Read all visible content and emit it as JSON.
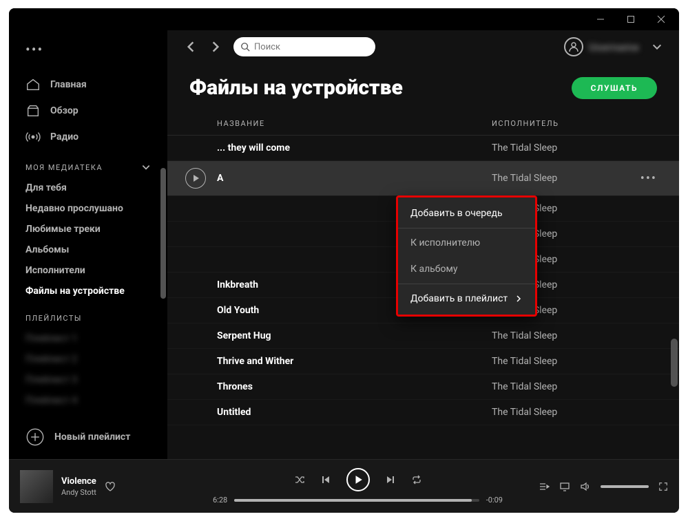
{
  "titlebar": {
    "min": "minimize",
    "max": "maximize",
    "close": "close"
  },
  "sidebar": {
    "nav": [
      {
        "label": "Главная",
        "icon": "home"
      },
      {
        "label": "Обзор",
        "icon": "browse"
      },
      {
        "label": "Радио",
        "icon": "radio"
      }
    ],
    "library_header": "МОЯ МЕДИАТЕКА",
    "library": [
      {
        "label": "Для тебя"
      },
      {
        "label": "Недавно прослушано"
      },
      {
        "label": "Любимые треки"
      },
      {
        "label": "Альбомы"
      },
      {
        "label": "Исполнители"
      },
      {
        "label": "Файлы на устройстве",
        "active": true
      }
    ],
    "playlists_header": "ПЛЕЙЛИСТЫ",
    "playlists": [
      "Плейлист 1",
      "Плейлист 2",
      "Плейлист 3",
      "Плейлист 4"
    ],
    "new_playlist": "Новый плейлист"
  },
  "search": {
    "placeholder": "Поиск"
  },
  "user": {
    "name": "Username"
  },
  "page": {
    "title": "Файлы на устройстве",
    "listen": "СЛУШАТЬ",
    "col_title": "НАЗВАНИЕ",
    "col_artist": "ИСПОЛНИТЕЛЬ"
  },
  "tracks": [
    {
      "title": "... they will come",
      "artist": "The Tidal Sleep"
    },
    {
      "title": "A",
      "artist": "The Tidal Sleep",
      "selected": true
    },
    {
      "title": "",
      "artist": "The Tidal Sleep"
    },
    {
      "title": "",
      "artist": "The Tidal Sleep"
    },
    {
      "title": "",
      "artist": "The Tidal Sleep"
    },
    {
      "title": "Inkbreath",
      "artist": "The Tidal Sleep"
    },
    {
      "title": "Old Youth",
      "artist": "The Tidal Sleep"
    },
    {
      "title": "Serpent Hug",
      "artist": "The Tidal Sleep"
    },
    {
      "title": "Thrive and Wither",
      "artist": "The Tidal Sleep"
    },
    {
      "title": "Thrones",
      "artist": "The Tidal Sleep"
    },
    {
      "title": "Untitled",
      "artist": "The Tidal Sleep"
    }
  ],
  "context_menu": {
    "add_queue": "Добавить в очередь",
    "to_artist": "К исполнителю",
    "to_album": "К альбому",
    "add_playlist": "Добавить в плейлист"
  },
  "player": {
    "track": "Violence",
    "artist": "Andy Stott",
    "elapsed": "6:28",
    "remaining": "-0:09"
  }
}
